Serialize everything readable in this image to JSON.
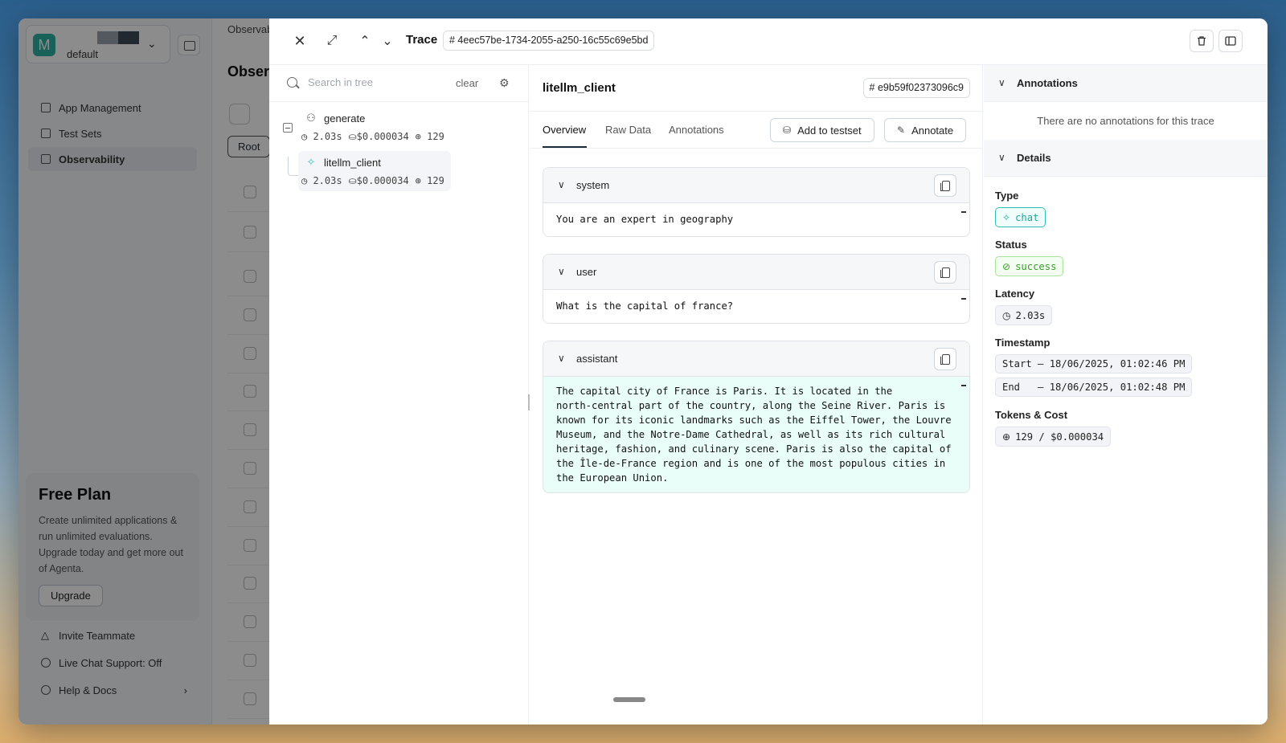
{
  "app": {
    "workspace": {
      "avatar": "M",
      "name": "default",
      "colors": [
        "#9aa3ad",
        "#3f4a56"
      ]
    },
    "nav": [
      {
        "label": "App Management",
        "icon": "grid-icon"
      },
      {
        "label": "Test Sets",
        "icon": "table-icon"
      },
      {
        "label": "Observability",
        "icon": "chart-icon",
        "active": true
      }
    ],
    "free_plan": {
      "title": "Free Plan",
      "text": "Create unlimited applications & run unlimited evaluations. Upgrade today and get more out of Agenta.",
      "button": "Upgrade"
    },
    "footer": [
      {
        "label": "Invite Teammate",
        "icon": "invite-icon"
      },
      {
        "label": "Live Chat Support: Off",
        "icon": "chat-bubble-icon"
      },
      {
        "label": "Help & Docs",
        "icon": "help-icon"
      }
    ],
    "breadcrumb": "Observabi",
    "page_title": "Observ",
    "root_button": "Root"
  },
  "drawer": {
    "title": "Trace",
    "trace_id": "# 4eec57be-1734-2055-a250-16c55c69e5bd",
    "search": {
      "placeholder": "Search in tree",
      "clear_label": "clear"
    },
    "tree": [
      {
        "name": "generate",
        "latency": "2.03s",
        "cost": "$0.000034",
        "tokens": "129"
      },
      {
        "name": "litellm_client",
        "latency": "2.03s",
        "cost": "$0.000034",
        "tokens": "129",
        "selected": true
      }
    ],
    "span": {
      "title": "litellm_client",
      "id": "# e9b59f02373096c9",
      "tabs": [
        "Overview",
        "Raw Data",
        "Annotations"
      ],
      "active_tab": "Overview",
      "add_to_testset": "Add to testset",
      "annotate": "Annotate",
      "messages": [
        {
          "role": "system",
          "content": "You are an expert in geography"
        },
        {
          "role": "user",
          "content": "What is the capital of france?"
        },
        {
          "role": "assistant",
          "content": "The capital city of France is Paris. It is located in the\nnorth-central part of the country, along the Seine River. Paris is\nknown for its iconic landmarks such as the Eiffel Tower, the Louvre\nMuseum, and the Notre-Dame Cathedral, as well as its rich cultural\nheritage, fashion, and culinary scene. Paris is also the capital of\nthe Île-de-France region and is one of the most populous cities in\nthe European Union."
        }
      ]
    },
    "info": {
      "annotations_title": "Annotations",
      "no_annotations": "There are no annotations for this trace",
      "details_title": "Details",
      "type_label": "Type",
      "type_value": "chat",
      "status_label": "Status",
      "status_value": "success",
      "latency_label": "Latency",
      "latency_value": "2.03s",
      "timestamp_label": "Timestamp",
      "start": "Start – 18/06/2025, 01:02:46 PM",
      "end": "End   – 18/06/2025, 01:02:48 PM",
      "tokens_label": "Tokens & Cost",
      "tokens_value": "129 / $0.000034"
    },
    "colors": {
      "accent": "#2fc0b2",
      "success": "#3a9a2c",
      "assistant_bg": "#e9fdf9"
    }
  }
}
